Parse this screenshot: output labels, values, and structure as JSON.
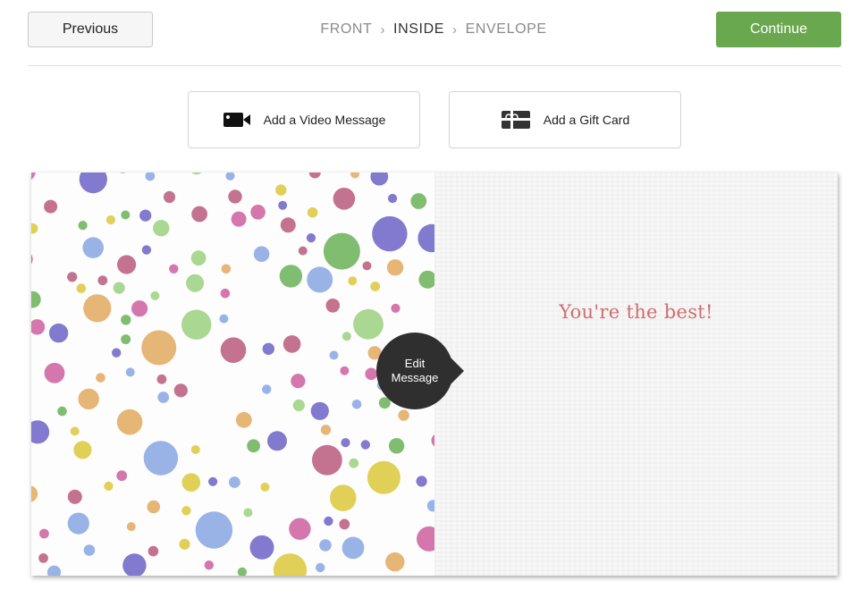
{
  "header": {
    "previous_label": "Previous",
    "continue_label": "Continue",
    "steps": [
      {
        "label": "FRONT",
        "active": false
      },
      {
        "label": "INSIDE",
        "active": true
      },
      {
        "label": "ENVELOPE",
        "active": false
      }
    ],
    "step_separator": "›"
  },
  "addons": {
    "video_label": "Add a Video Message",
    "video_icon": "video-camera-icon",
    "gift_label": "Add a Gift Card",
    "gift_icon": "gift-card-icon"
  },
  "card": {
    "message": "You're the best!",
    "edit_line1": "Edit",
    "edit_line2": "Message",
    "dot_colors": [
      "#6b63c6",
      "#cc5f9f",
      "#6ab257",
      "#e2a95f",
      "#88a6e3",
      "#dcc83a",
      "#9bd07e",
      "#b95a7c"
    ],
    "accent_colors": {
      "continue": "#6aa84f",
      "message_text": "#cf6e6e",
      "edit_bubble": "#2f2f2f"
    }
  }
}
